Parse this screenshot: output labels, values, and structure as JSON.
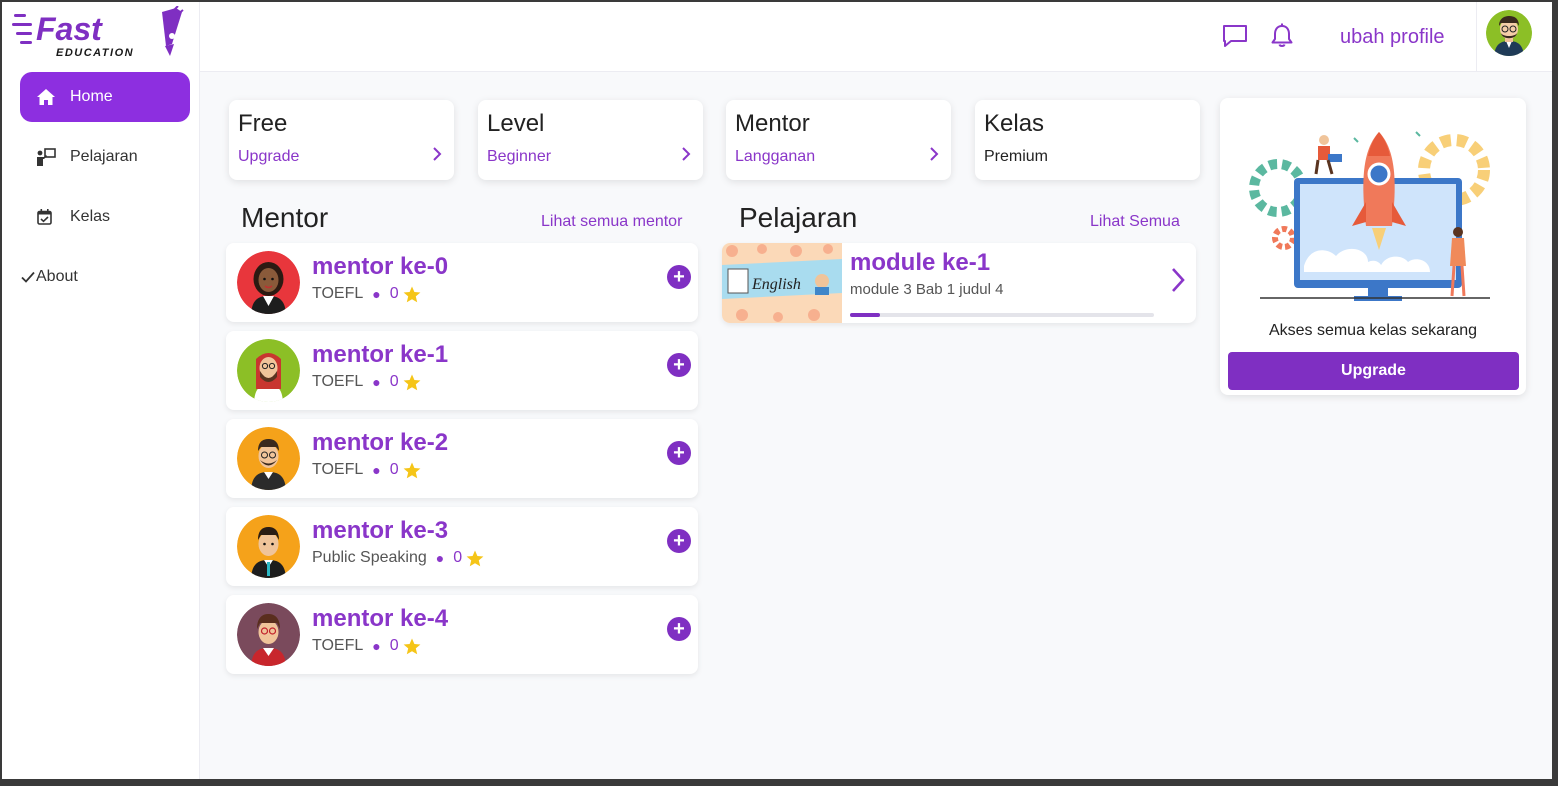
{
  "brand": {
    "name": "Fast",
    "tagline": "EDUCATION",
    "primary_color": "#7f2fc2"
  },
  "sidebar": {
    "items": [
      {
        "label": "Home",
        "icon": "home-icon",
        "active": true
      },
      {
        "label": "Pelajaran",
        "icon": "teacher-board-icon",
        "active": false
      },
      {
        "label": "Kelas",
        "icon": "calendar-check-icon",
        "active": false
      },
      {
        "label": "About",
        "icon": "check-icon",
        "active": false
      }
    ]
  },
  "header": {
    "chat_icon": "chat-icon",
    "bell_icon": "bell-icon",
    "profile_link": "ubah profile"
  },
  "stats": [
    {
      "title": "Free",
      "sub": "Upgrade",
      "arrow": true
    },
    {
      "title": "Level",
      "sub": "Beginner",
      "arrow": true
    },
    {
      "title": "Mentor",
      "sub": "Langganan",
      "arrow": true
    },
    {
      "title": "Kelas",
      "sub": "Premium",
      "arrow": false
    }
  ],
  "mentor_section": {
    "title": "Mentor",
    "link": "Lihat semua mentor",
    "mentors": [
      {
        "name": "mentor ke-0",
        "subject": "TOEFL",
        "rating": "0"
      },
      {
        "name": "mentor ke-1",
        "subject": "TOEFL",
        "rating": "0"
      },
      {
        "name": "mentor ke-2",
        "subject": "TOEFL",
        "rating": "0"
      },
      {
        "name": "mentor ke-3",
        "subject": "Public Speaking",
        "rating": "0"
      },
      {
        "name": "mentor ke-4",
        "subject": "TOEFL",
        "rating": "0"
      }
    ]
  },
  "pelajaran_section": {
    "title": "Pelajaran",
    "link": "Lihat Semua",
    "modules": [
      {
        "title": "module ke-1",
        "sub": "module 3 Bab 1 judul 4",
        "thumb_text": "English",
        "progress": 0.1
      }
    ]
  },
  "promo": {
    "text": "Akses semua kelas sekarang",
    "button": "Upgrade"
  }
}
